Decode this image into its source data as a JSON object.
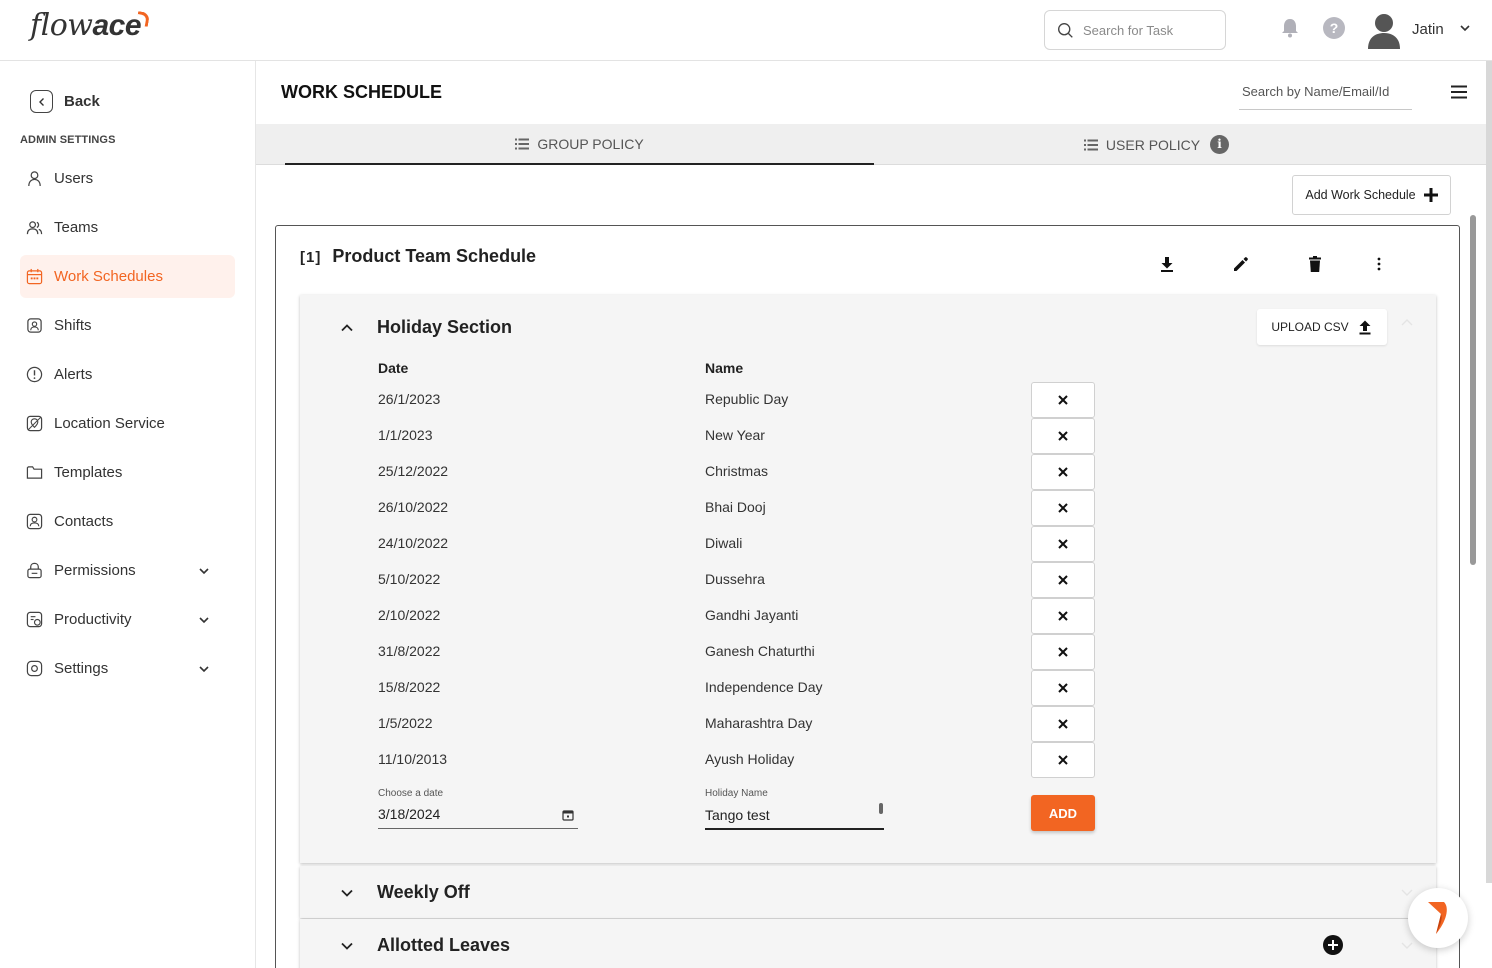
{
  "brand": {
    "logo_text_1": "flow",
    "logo_text_2": "ace",
    "accent": "#f26522"
  },
  "topbar": {
    "search_placeholder": "Search for Task",
    "user_name": "Jatin"
  },
  "sidebar": {
    "back_label": "Back",
    "section_header": "ADMIN SETTINGS",
    "items": [
      {
        "label": "Users",
        "icon": "user-icon",
        "active": false,
        "expandable": false
      },
      {
        "label": "Teams",
        "icon": "team-icon",
        "active": false,
        "expandable": false
      },
      {
        "label": "Work Schedules",
        "icon": "calendar-icon",
        "active": true,
        "expandable": false
      },
      {
        "label": "Shifts",
        "icon": "shift-icon",
        "active": false,
        "expandable": false
      },
      {
        "label": "Alerts",
        "icon": "alert-icon",
        "active": false,
        "expandable": false
      },
      {
        "label": "Location Service",
        "icon": "location-icon",
        "active": false,
        "expandable": false
      },
      {
        "label": "Templates",
        "icon": "folder-icon",
        "active": false,
        "expandable": false
      },
      {
        "label": "Contacts",
        "icon": "contact-icon",
        "active": false,
        "expandable": false
      },
      {
        "label": "Permissions",
        "icon": "lock-icon",
        "active": false,
        "expandable": true
      },
      {
        "label": "Productivity",
        "icon": "productivity-icon",
        "active": false,
        "expandable": true
      },
      {
        "label": "Settings",
        "icon": "settings-icon",
        "active": false,
        "expandable": true
      }
    ]
  },
  "main": {
    "page_title": "WORK SCHEDULE",
    "name_search_placeholder": "Search by Name/Email/Id",
    "tabs": [
      {
        "label": "GROUP POLICY",
        "active": true
      },
      {
        "label": "USER POLICY",
        "active": false
      }
    ],
    "add_schedule_label": "Add Work Schedule",
    "schedule": {
      "index": "[1]",
      "title": "Product Team Schedule",
      "holiday_section": {
        "title": "Holiday Section",
        "upload_label": "UPLOAD CSV",
        "date_header": "Date",
        "name_header": "Name",
        "holidays": [
          {
            "date": "26/1/2023",
            "name": "Republic Day"
          },
          {
            "date": "1/1/2023",
            "name": "New Year"
          },
          {
            "date": "25/12/2022",
            "name": "Christmas"
          },
          {
            "date": "26/10/2022",
            "name": "Bhai Dooj"
          },
          {
            "date": "24/10/2022",
            "name": "Diwali"
          },
          {
            "date": "5/10/2022",
            "name": "Dussehra"
          },
          {
            "date": "2/10/2022",
            "name": "Gandhi Jayanti"
          },
          {
            "date": "31/8/2022",
            "name": "Ganesh Chaturthi"
          },
          {
            "date": "15/8/2022",
            "name": "Independence Day"
          },
          {
            "date": "1/5/2022",
            "name": "Maharashtra Day"
          },
          {
            "date": "11/10/2013",
            "name": "Ayush Holiday"
          }
        ],
        "date_field_label": "Choose a date",
        "date_field_value": "3/18/2024",
        "name_field_label": "Holiday Name",
        "name_field_value": "Tango test",
        "add_label": "ADD"
      },
      "weekly_off_title": "Weekly Off",
      "allotted_leaves_title": "Allotted Leaves"
    }
  }
}
